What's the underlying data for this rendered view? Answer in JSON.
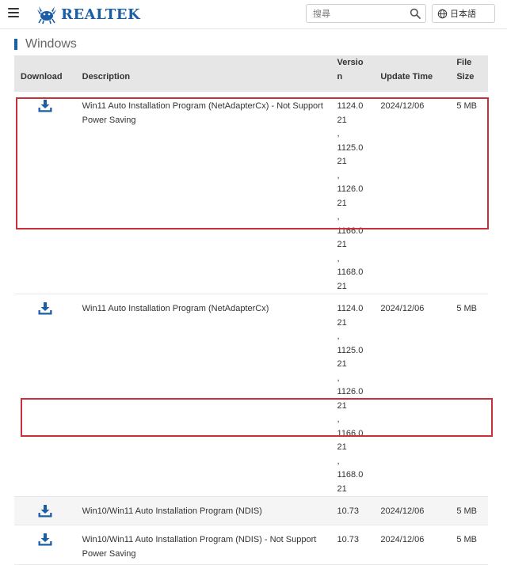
{
  "header": {
    "logo_text": "REALTEK",
    "search_placeholder": "搜尋",
    "language": "日本語"
  },
  "section": {
    "title": "Windows"
  },
  "table": {
    "columns": {
      "download": "Download",
      "description": "Description",
      "version": "Version",
      "update_time": "Update Time",
      "file_size": "File Size"
    },
    "rows": [
      {
        "description": "Win11 Auto Installation Program (NetAdapterCx) - Not Support Power Saving",
        "versions": [
          "1124.021",
          "1125.021",
          "1126.021",
          "1166.021",
          "1168.021"
        ],
        "update_time": "2024/12/06",
        "file_size": "5 MB"
      },
      {
        "description": "Win11 Auto Installation Program (NetAdapterCx)",
        "versions": [
          "1124.021",
          "1125.021",
          "1126.021",
          "1166.021",
          "1168.021"
        ],
        "update_time": "2024/12/06",
        "file_size": "5 MB"
      },
      {
        "description": "Win10/Win11 Auto Installation Program (NDIS)",
        "versions": [
          "10.73"
        ],
        "update_time": "2024/12/06",
        "file_size": "5 MB"
      },
      {
        "description": "Win10/Win11 Auto Installation Program (NDIS) - Not Support Power Saving",
        "versions": [
          "10.73"
        ],
        "update_time": "2024/12/06",
        "file_size": "5 MB"
      }
    ]
  },
  "icons": {
    "menu": "hamburger-menu-icon",
    "logo": "realtek-crab-logo",
    "search": "search-icon",
    "language": "globe-icon",
    "download": "download-icon"
  },
  "colors": {
    "brand": "#1a5ea8",
    "highlight_box": "#c8303a",
    "header_row": "#e6e6e6",
    "striped_row": "#f5f5f5"
  }
}
